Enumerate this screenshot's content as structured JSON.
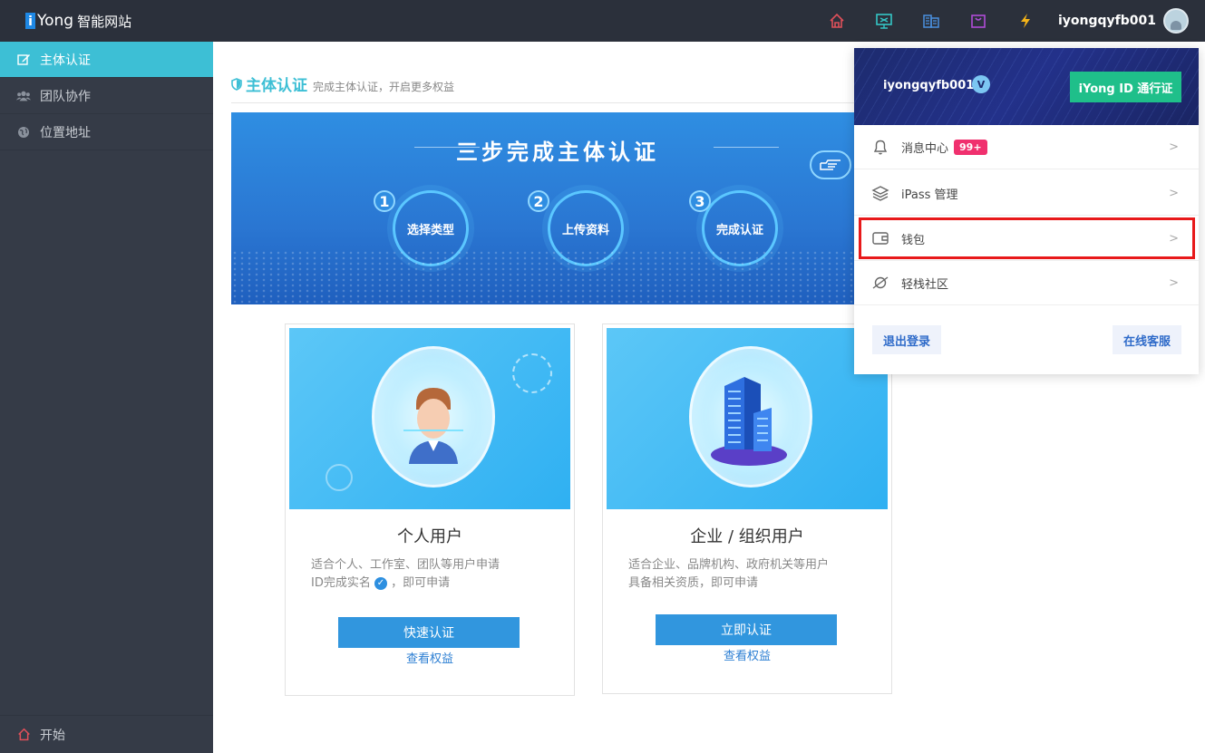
{
  "app": {
    "logo_mark": "i",
    "logo_name": "Yong",
    "logo_sub": "智能网站"
  },
  "topbar": {
    "icons": [
      "home-icon",
      "monitor-icon",
      "building-icon",
      "bag-icon",
      "lightning-icon"
    ],
    "username": "iyongqyfb001"
  },
  "sidebar": {
    "items": [
      {
        "label": "主体认证",
        "icon": "edit-icon",
        "active": true
      },
      {
        "label": "团队协作",
        "icon": "team-icon",
        "active": false
      },
      {
        "label": "位置地址",
        "icon": "globe-icon",
        "active": false
      }
    ],
    "bottom_label": "开始"
  },
  "main": {
    "title": "主体认证",
    "subtitle": "完成主体认证，开启更多权益",
    "banner": {
      "title": "三步完成主体认证",
      "steps": [
        {
          "num": "1",
          "label": "选择类型"
        },
        {
          "num": "2",
          "label": "上传资料"
        },
        {
          "num": "3",
          "label": "完成认证"
        }
      ]
    },
    "cards": [
      {
        "title": "个人用户",
        "desc_line1": "适合个人、工作室、团队等用户申请",
        "desc_line2a": "ID完成实名",
        "desc_line2b": "，即可申请",
        "button": "快速认证",
        "link": "查看权益"
      },
      {
        "title": "企业 / 组织用户",
        "desc_line1": "适合企业、品牌机构、政府机关等用户",
        "desc_line2a": "具备相关资质，即可申请",
        "desc_line2b": "",
        "button": "立即认证",
        "link": "查看权益"
      }
    ]
  },
  "dropdown": {
    "username": "iyongqyfb001",
    "verified_mark": "V",
    "id_button": "iYong ID 通行证",
    "items": [
      {
        "label": "消息中心",
        "badge": "99+",
        "icon": "bell-icon",
        "arrow": ">"
      },
      {
        "label": "iPass 管理",
        "icon": "layers-icon",
        "arrow": ">"
      },
      {
        "label": "钱包",
        "icon": "wallet-icon",
        "arrow": ">"
      },
      {
        "label": "轻栈社区",
        "icon": "planet-icon",
        "arrow": ">"
      }
    ],
    "logout": "退出登录",
    "support": "在线客服"
  },
  "colors": {
    "topbar": "#2b303b",
    "sidebar": "#353b47",
    "accent": "#3dbfd5",
    "button_blue": "#3196de",
    "id_green": "#1fbf8a",
    "badge_pink": "#f0306e",
    "highlight_red": "#e8191a"
  }
}
